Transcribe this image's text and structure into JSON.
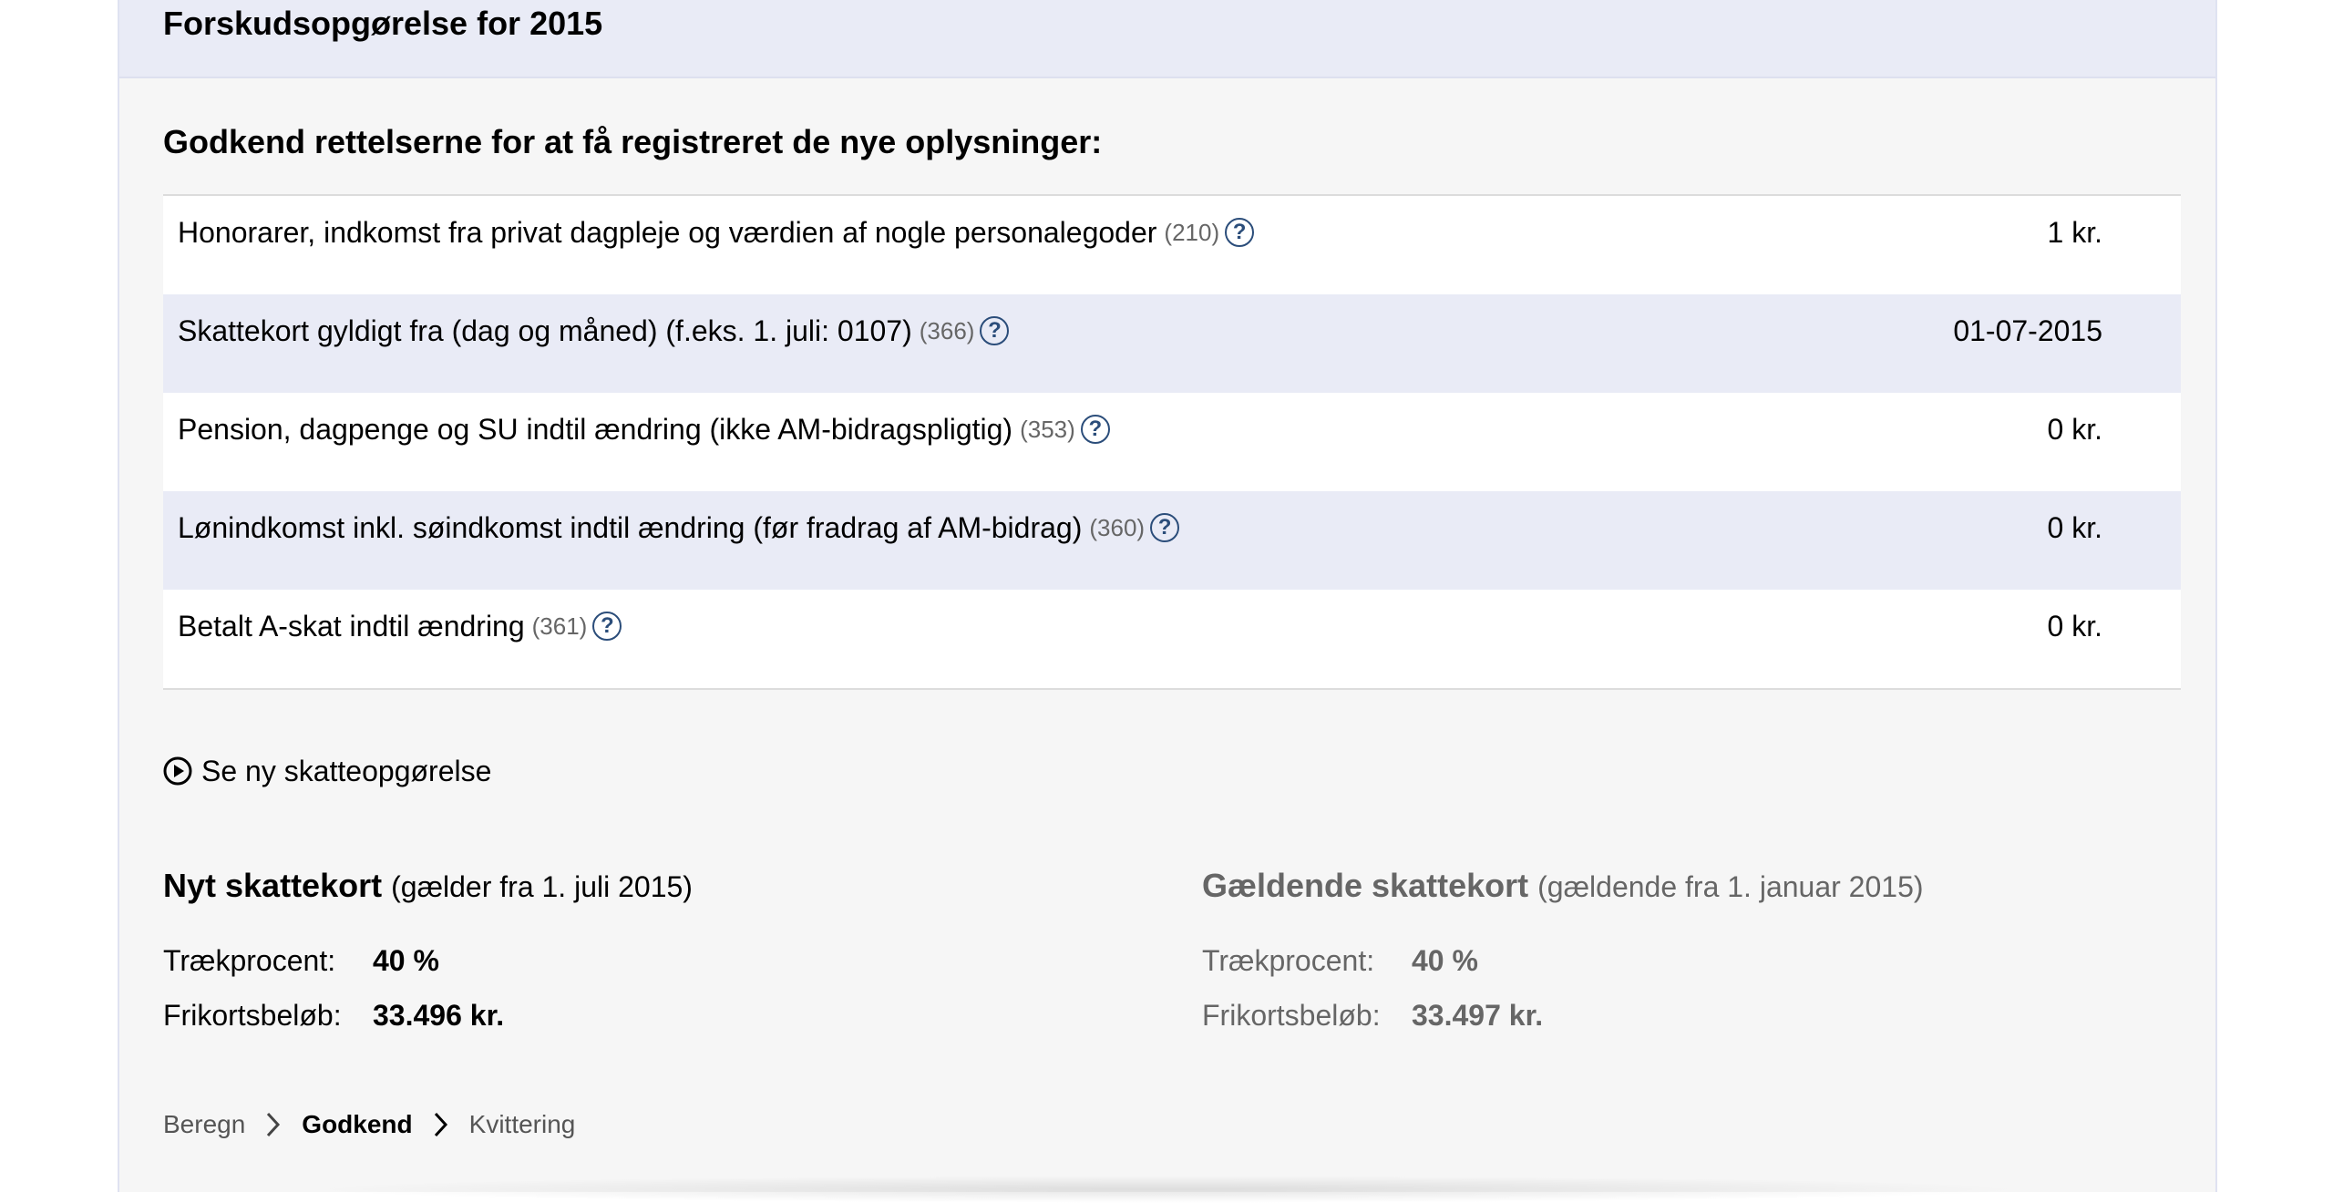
{
  "header": {
    "title": "Forskudsopgørelse for 2015"
  },
  "section": {
    "heading": "Godkend rettelserne for at få registreret de nye oplysninger:"
  },
  "rows": [
    {
      "label": "Honorarer, indkomst fra privat dagpleje og værdien af nogle personalegoder",
      "code": "(210)",
      "value": "1 kr."
    },
    {
      "label": "Skattekort gyldigt fra (dag og måned) (f.eks. 1. juli: 0107)",
      "code": "(366)",
      "value": "01-07-2015"
    },
    {
      "label": "Pension, dagpenge og SU indtil ændring (ikke AM-bidragspligtig)",
      "code": "(353)",
      "value": "0 kr."
    },
    {
      "label": "Lønindkomst inkl. søindkomst indtil ændring (før fradrag af AM-bidrag)",
      "code": "(360)",
      "value": "0 kr."
    },
    {
      "label": "Betalt A-skat indtil ændring",
      "code": "(361)",
      "value": "0 kr."
    }
  ],
  "help_symbol": "?",
  "see_link": {
    "label": "Se ny skatteopgørelse",
    "icon": "play-circle-icon"
  },
  "new_card": {
    "title": "Nyt skattekort",
    "subtitle": "(gælder fra 1. juli 2015)",
    "rate_label": "Trækprocent:",
    "rate_value": "40 %",
    "allowance_label": "Frikortsbeløb:",
    "allowance_value": "33.496 kr."
  },
  "current_card": {
    "title": "Gældende skattekort",
    "subtitle": "(gældende fra 1. januar 2015)",
    "rate_label": "Trækprocent:",
    "rate_value": "40 %",
    "allowance_label": "Frikortsbeløb:",
    "allowance_value": "33.497 kr."
  },
  "breadcrumb": {
    "steps": [
      "Beregn",
      "Godkend",
      "Kvittering"
    ],
    "active_index": 1,
    "separator_icon": "chevron-right-icon"
  },
  "colors": {
    "header_bg": "#e9ebf6",
    "row_alt_bg": "#e9ebf6",
    "panel_bg": "#f6f6f6",
    "help_icon": "#2b4d7a"
  }
}
